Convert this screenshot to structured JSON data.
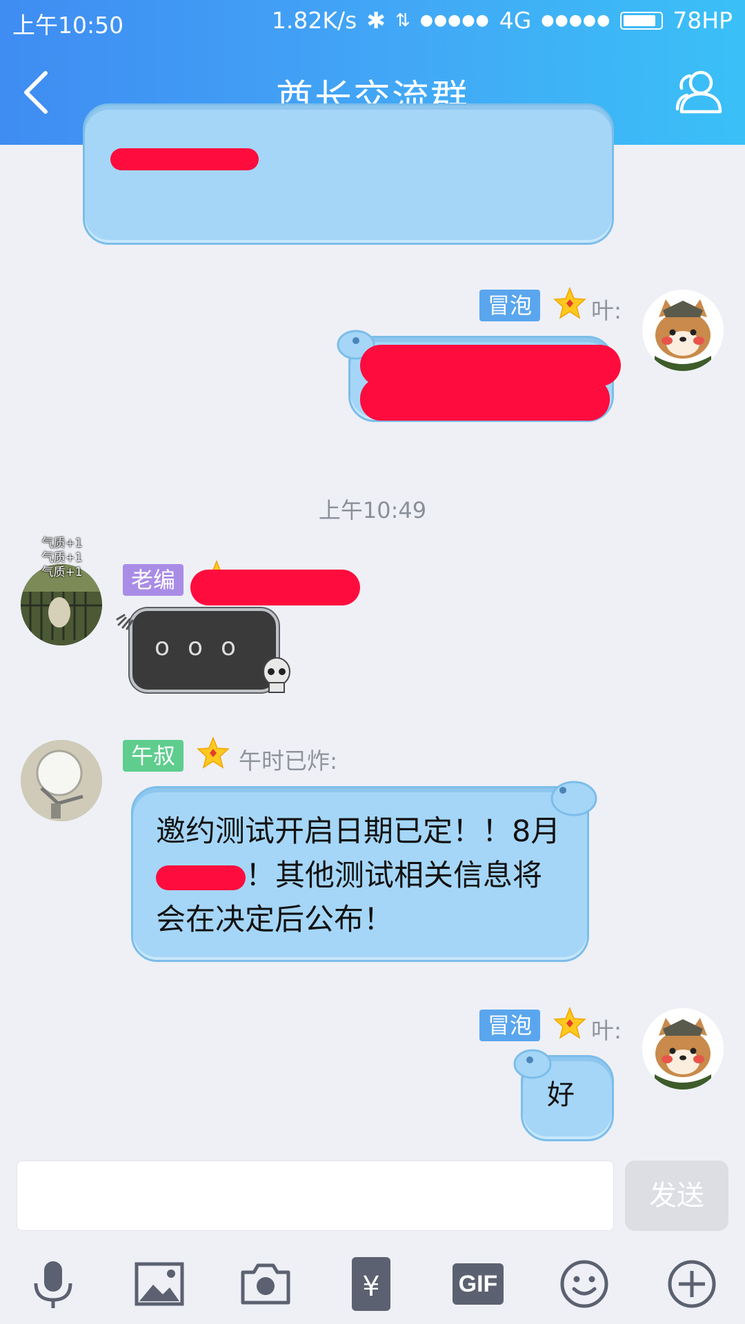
{
  "status_bar": {
    "time": "上午10:50",
    "speed": "1.82K/s",
    "network": "4G",
    "battery_label": "78HP",
    "battery_level": 0.78
  },
  "header": {
    "title": "酋长交流群",
    "back_icon": "chevron-left-icon",
    "members_icon": "group-members-icon"
  },
  "messages": [
    {
      "side": "right",
      "badge": "冒泡",
      "badge_color": "#5aa6ee",
      "sender": "叶:",
      "text": "好"
    },
    {
      "divider_time": "上午10:49"
    },
    {
      "side": "left",
      "badge": "老编",
      "badge_color": "#a98ce6",
      "avatar_overlay": [
        "气质+1",
        "气质+1",
        "气质+1"
      ]
    },
    {
      "side": "left",
      "badge": "午叔",
      "badge_color": "#5fcd8d",
      "sender": "午时已炸:",
      "text": "邀约测试开启日期已定！！8月",
      "text_cont": "！其他测试相关信息将会在决定后公布！"
    }
  ],
  "input": {
    "placeholder": "",
    "send_label": "发送"
  },
  "toolbar": [
    "microphone-icon",
    "image-icon",
    "camera-icon",
    "red-packet-icon",
    "gif-icon",
    "emoji-icon",
    "plus-icon"
  ],
  "toolbar_gif_label": "GIF",
  "toolbar_red_packet_label": "¥"
}
